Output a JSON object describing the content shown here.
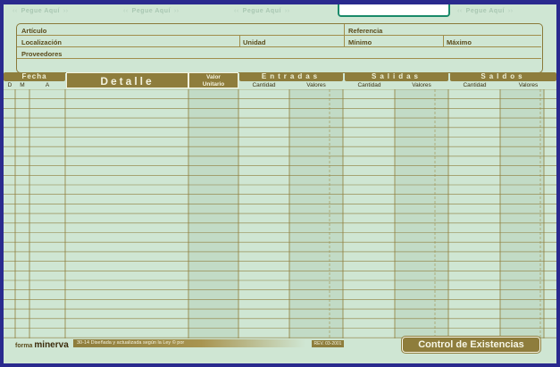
{
  "tabs": [
    "Pegue Aquí",
    "Pegue Aquí",
    "Pegue Aquí",
    "Pegue Aquí",
    "Pegue Aquí"
  ],
  "header": {
    "articulo": "Artículo",
    "referencia": "Referencia",
    "localizacion": "Localización",
    "unidad": "Unidad",
    "minimo": "Mínimo",
    "maximo": "Máximo",
    "proveedores": "Proveedores"
  },
  "columns": {
    "fecha": "Fecha",
    "d": "D",
    "m": "M",
    "a": "A",
    "detalle": "Detalle",
    "valor_unitario_1": "Valor",
    "valor_unitario_2": "Unitario",
    "entradas": "Entradas",
    "salidas": "Salidas",
    "saldos": "Saldos",
    "cantidad": "Cantidad",
    "valores": "Valores"
  },
  "footer": {
    "brand_prefix": "forma",
    "brand": "minerva",
    "note": "30-14 Diseñada y actualizada según la Ley © por",
    "rev": "REV. 03-2001",
    "title": "Control de Existencias"
  },
  "colors": {
    "paper": "#cfe6d3",
    "ink": "#8e7d3c",
    "frame": "#2a2a8e"
  }
}
